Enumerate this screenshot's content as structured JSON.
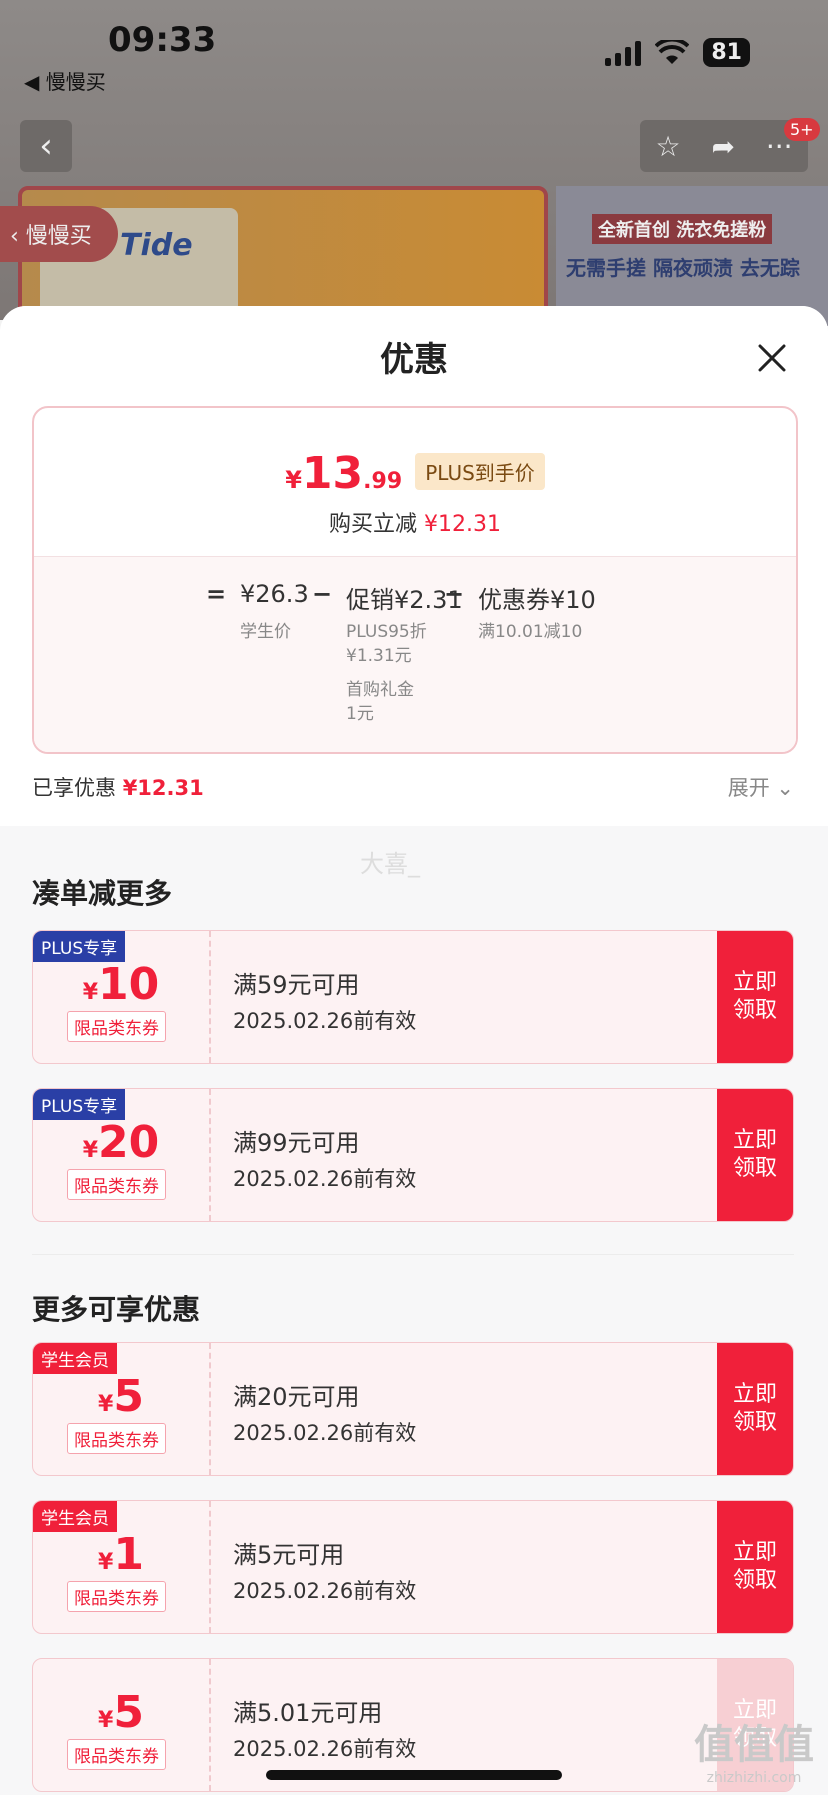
{
  "status_bar": {
    "time": "09:33",
    "back_app": "◀ 慢慢买",
    "battery": "81"
  },
  "nav": {
    "back_icon": "‹",
    "star_icon": "☆",
    "share_icon": "➦",
    "more_icon": "···",
    "badge": "5+"
  },
  "background": {
    "side_pill": "‹ 慢慢买",
    "brand": "Tide",
    "promo_right_line1": "全新首创 洗衣免搓粉",
    "promo_right_line2": "无需手搓 隔夜顽渍 去无踪"
  },
  "sheet": {
    "title": "优惠",
    "price": {
      "currency": "¥",
      "integer": "13",
      "decimal": ".99",
      "tag": "PLUS到手价"
    },
    "instant": {
      "label": "购买立减",
      "value": "¥12.31"
    },
    "formula": {
      "eq": "=",
      "base_value": "¥26.3",
      "base_label": "学生价",
      "minus1": "−",
      "promo_value": "促销¥2.31",
      "promo_detail_1a": "PLUS95折",
      "promo_detail_1b": "¥1.31元",
      "promo_detail_2a": "首购礼金",
      "promo_detail_2b": "1元",
      "minus2": "−",
      "coupon_value": "优惠券¥10",
      "coupon_detail": "满10.01减10"
    },
    "enjoyed": {
      "label": "已享优惠",
      "value": "¥12.31"
    },
    "expand": "展开",
    "watermark": "大喜_"
  },
  "section_more_discount": "凑单减更多",
  "section_more_offers": "更多可享优惠",
  "coupons": [
    {
      "tag": "PLUS专享",
      "currency": "¥",
      "amount": "10",
      "category": "限品类东券",
      "condition": "满59元可用",
      "validity": "2025.02.26前有效",
      "claim": "立即领取"
    },
    {
      "tag": "PLUS专享",
      "currency": "¥",
      "amount": "20",
      "category": "限品类东券",
      "condition": "满99元可用",
      "validity": "2025.02.26前有效",
      "claim": "立即领取"
    },
    {
      "tag": "学生会员",
      "currency": "¥",
      "amount": "5",
      "category": "限品类东券",
      "condition": "满20元可用",
      "validity": "2025.02.26前有效",
      "claim": "立即领取"
    },
    {
      "tag": "学生会员",
      "currency": "¥",
      "amount": "1",
      "category": "限品类东券",
      "condition": "满5元可用",
      "validity": "2025.02.26前有效",
      "claim": "立即领取"
    },
    {
      "tag": "",
      "currency": "¥",
      "amount": "5",
      "category": "限品类东券",
      "condition": "满5.01元可用",
      "validity": "2025.02.26前有效",
      "claim": "立即领取"
    }
  ],
  "site_mark": {
    "logo": "值值值",
    "url": "zhizhizhi.com"
  },
  "colors": {
    "accent_red": "#f0203a",
    "plus_blue": "#2a3fa6",
    "tag_gold": "#fbe7c9"
  }
}
